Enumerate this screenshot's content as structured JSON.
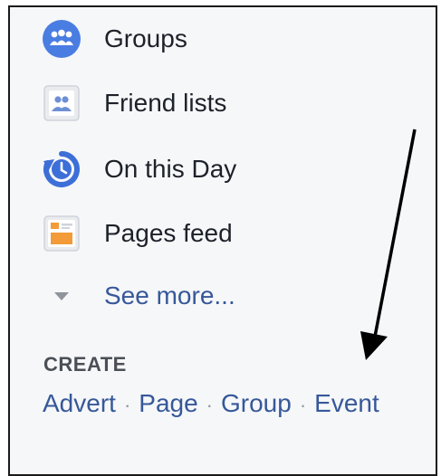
{
  "sidebar": {
    "items": [
      {
        "label": "Groups",
        "icon": "groups-icon"
      },
      {
        "label": "Friend lists",
        "icon": "friend-lists-icon"
      },
      {
        "label": "On this Day",
        "icon": "on-this-day-icon"
      },
      {
        "label": "Pages feed",
        "icon": "pages-feed-icon"
      }
    ],
    "see_more": {
      "label": "See more...",
      "icon": "triangle-down-icon"
    }
  },
  "create": {
    "heading": "CREATE",
    "separator": "·",
    "links": [
      "Advert",
      "Page",
      "Group",
      "Event"
    ]
  },
  "colors": {
    "link": "#365899",
    "text": "#1d2129",
    "heading": "#4b4f56",
    "icon_blue": "#4a7de2",
    "pages_orange": "#f29b38",
    "annotation_arrow": "#000000"
  }
}
